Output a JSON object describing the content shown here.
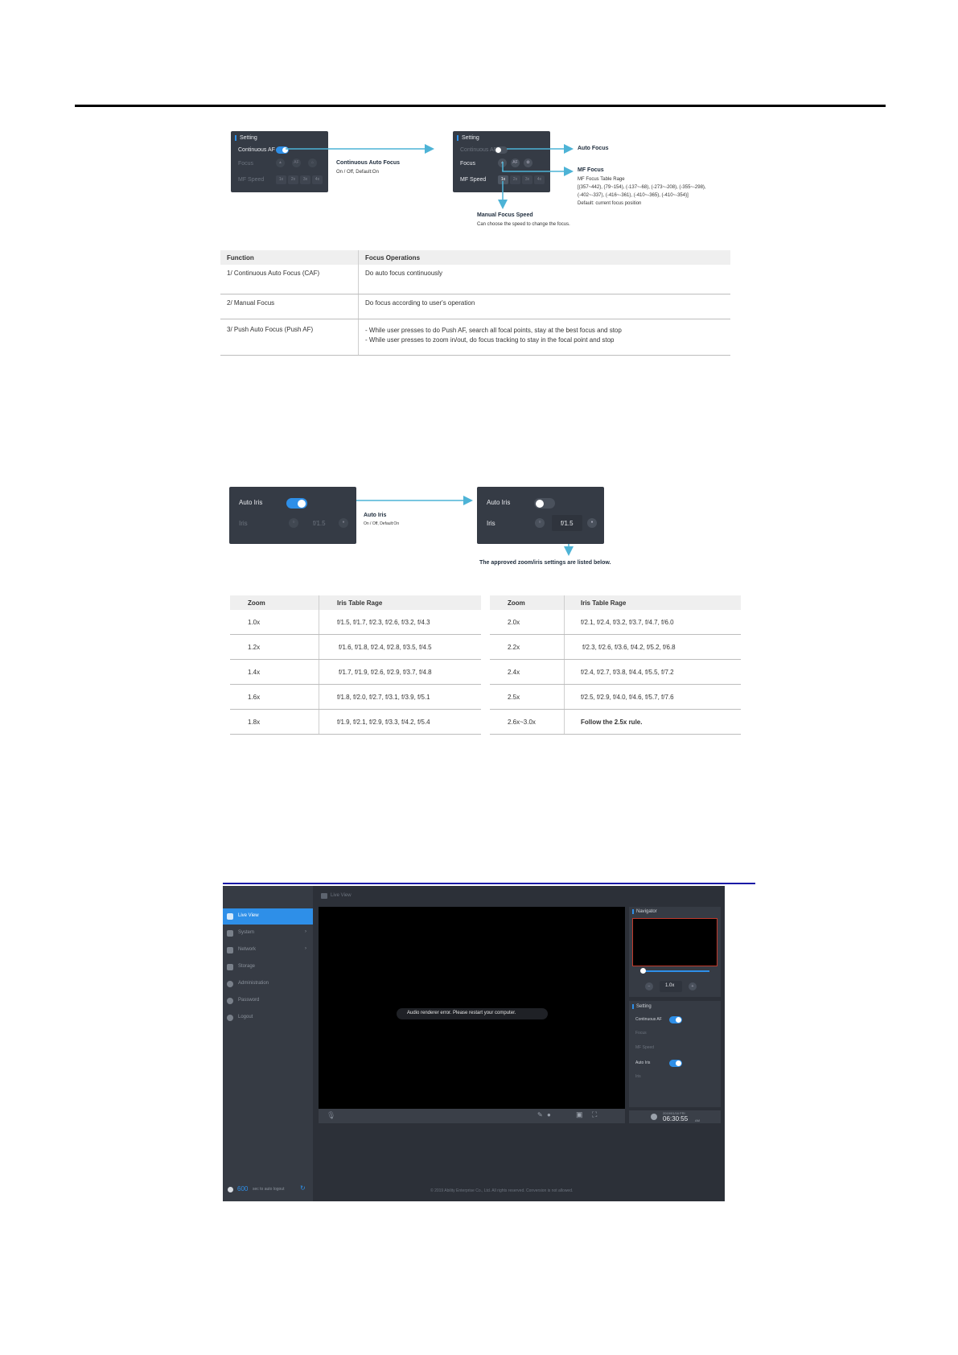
{
  "focus_section": {
    "panel_left": {
      "header": "Setting",
      "continuous_af_label": "Continuous AF",
      "focus_label": "Focus",
      "mf_speed_label": "MF Speed",
      "speed_options": [
        "1x",
        "2x",
        "3x",
        "4x"
      ],
      "af_button": "AF"
    },
    "panel_right": {
      "header": "Setting",
      "continuous_af_label": "Continuous AF",
      "focus_label": "Focus",
      "mf_speed_label": "MF Speed",
      "speed_options": [
        "1x",
        "2x",
        "3x",
        "4x"
      ],
      "af_button": "AF"
    },
    "annotations": {
      "caf_title": "Continuous Auto Focus",
      "caf_sub": "On / Off, Default:On",
      "auto_focus": "Auto Focus",
      "mf_focus_title": "MF Focus",
      "mf_focus_table": "MF Focus Table Rage",
      "mf_focus_range_1": "[(357~442), (79~154), (-137~-68), (-273~-208), (-355~-298),",
      "mf_focus_range_2": "(-402~-337), (-416~-361), (-410~-365), (-410~-354)]",
      "mf_focus_default": "Default: current focus position",
      "mfs_title": "Manual Focus Speed",
      "mfs_sub": "Can choose the speed to change the focus."
    },
    "table": {
      "headers": [
        "Function",
        "Focus Operations"
      ],
      "rows": [
        {
          "function": "1/ Continuous Auto Focus (CAF)",
          "ops1": "Do auto focus continuously",
          "ops2": ""
        },
        {
          "function": "2/ Manual Focus",
          "ops1": "Do focus according to user's operation",
          "ops2": ""
        },
        {
          "function": "3/  Push Auto Focus (Push AF)",
          "ops1": "- While user presses to do Push AF, search all focal points, stay at the best focus and stop",
          "ops2": "- While user presses to zoom in/out, do focus tracking to stay in the focal point and stop"
        }
      ]
    }
  },
  "iris_section": {
    "panel_left": {
      "auto_iris_label": "Auto Iris",
      "iris_label": "Iris",
      "iris_value": "f/1.5"
    },
    "panel_right": {
      "auto_iris_label": "Auto Iris",
      "iris_label": "Iris",
      "iris_value": "f/1.5"
    },
    "annotations": {
      "auto_iris_title": "Auto Iris",
      "auto_iris_sub": "On / Off, Default:On",
      "approved": "The approved zoom/iris settings are listed below."
    },
    "table_left": {
      "headers": [
        "Zoom",
        "Iris Table Rage"
      ],
      "rows": [
        [
          "1.0x",
          "f/1.5, f/1.7, f/2.3, f/2.6, f/3.2, f/4.3"
        ],
        [
          "1.2x",
          "f/1.6, f/1.8, f/2.4, f/2.8, f/3.5, f/4.5"
        ],
        [
          "1.4x",
          "f/1.7, f/1.9, f/2.6, f/2.9, f/3.7, f/4.8"
        ],
        [
          "1.6x",
          "f/1.8, f/2.0, f/2.7, f/3.1, f/3.9, f/5.1"
        ],
        [
          "1.8x",
          "f/1.9, f/2.1, f/2.9, f/3.3, f/4.2, f/5.4"
        ]
      ]
    },
    "table_right": {
      "headers": [
        "Zoom",
        "Iris Table Rage"
      ],
      "rows": [
        [
          "2.0x",
          "f/2.1, f/2.4, f/3.2, f/3.7, f/4.7, f/6.0"
        ],
        [
          "2.2x",
          "f/2.3, f/2.6, f/3.6, f/4.2, f/5.2, f/6.8"
        ],
        [
          "2.4x",
          "f/2.4, f/2.7, f/3.8, f/4.4, f/5.5, f/7.2"
        ],
        [
          "2.5x",
          "f/2.5, f/2.9, f/4.0, f/4.6, f/5.7, f/7.6"
        ],
        [
          "2.6x~3.0x",
          "Follow the 2.5x rule."
        ]
      ]
    }
  },
  "app": {
    "page_title": "Live View",
    "sidebar": [
      {
        "label": "Live View",
        "active": true,
        "chevron": ""
      },
      {
        "label": "System",
        "active": false,
        "chevron": "›"
      },
      {
        "label": "Network",
        "active": false,
        "chevron": "›"
      },
      {
        "label": "Storage",
        "active": false,
        "chevron": ""
      },
      {
        "label": "Administration",
        "active": false,
        "chevron": ""
      },
      {
        "label": "Password",
        "active": false,
        "chevron": ""
      },
      {
        "label": "Logout",
        "active": false,
        "chevron": ""
      }
    ],
    "timer_value": "600",
    "timer_label": "sec to auto logout",
    "video_message": "Audio renderer error. Please restart your computer.",
    "navigator_label": "Navigator",
    "zoom_value": "1.0x",
    "setting_label": "Setting",
    "continuous_af": "Continuous AF",
    "focus": "Focus",
    "mf_speed": "MF Speed",
    "auto_iris": "Auto Iris",
    "iris": "Iris",
    "clock_date": "2019/01/16 FRI",
    "clock_time": "06:30:55",
    "clock_ampm": "AM",
    "footer": "© 2019 Ability Enterprise Co., Ltd. All rights reserved.   Conversion is not allowed."
  }
}
